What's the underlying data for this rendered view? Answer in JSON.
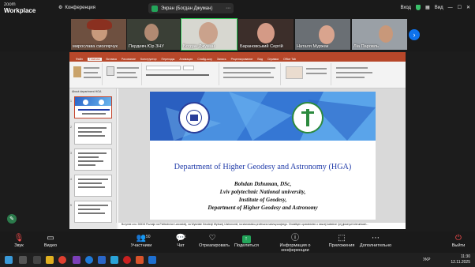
{
  "app": {
    "name_line1": "zoom",
    "name_line2": "Workplace",
    "conference_label": "Конференция"
  },
  "screen_share": {
    "label": "Экран (Богдан Джуман)"
  },
  "top_right": {
    "enter_label": "Вход",
    "view_label": "Вид"
  },
  "participants": [
    {
      "name": "мирослава смолярчук"
    },
    {
      "name": "Пердевч.Юр ЗНУ"
    },
    {
      "name": "Богдан Джуман"
    },
    {
      "name": "Барановський Сергій"
    },
    {
      "name": "Наталя Муржак"
    },
    {
      "name": "Ліа Паровль"
    }
  ],
  "ppt": {
    "tabs": [
      "Файл",
      "Главная",
      "Вставка",
      "Рисование",
      "Конструктор",
      "Переходы",
      "Анимация",
      "Слайд-шоу",
      "Запись",
      "Рецензирование",
      "Вид",
      "Справка",
      "Office Tab"
    ],
    "active_tab": "Главная",
    "thumb_pane_header": "About department HGA",
    "slide_numbers": [
      "1",
      "2",
      "3",
      "4",
      "5"
    ],
    "slide": {
      "title": "Department of Higher Geodesy and Astronomy (HGA)",
      "author": "Bohdan Dzhuman, DSc,",
      "line2": "Lviv polytechnic National university,",
      "line3": "Institute of Geodesy,",
      "line4": "Department of Higher Geodesy and Astronomy"
    },
    "notes": "Вступне сло: DDDD Poznaje na Politechnice Lwowskiej, na Wydziale Geodezji Wyższej i Astronomii, na stanowisku profesora nadzwyczajnego. Chciałbym opowiedzieć o naszej katedrze i jej głównych kierunkach..."
  },
  "toolbar": {
    "sound": "Звук",
    "video": "Видео",
    "participants": "Участники",
    "participants_count": "50",
    "chat": "Чат",
    "chat_count": "1",
    "react": "Отреагировать",
    "share": "Поделиться",
    "info": "Информация о конференции",
    "apps": "Приложения",
    "more": "Дополнительно",
    "leave": "Выйти"
  },
  "taskbar": {
    "lang": "УКР",
    "time": "11:30",
    "date": "12.11.2025"
  },
  "colors": {
    "accent_ppt": "#b7472a",
    "zoom_blue": "#0e72ed",
    "share_green": "#23a55a",
    "slide_title_blue": "#1f3aa8"
  }
}
